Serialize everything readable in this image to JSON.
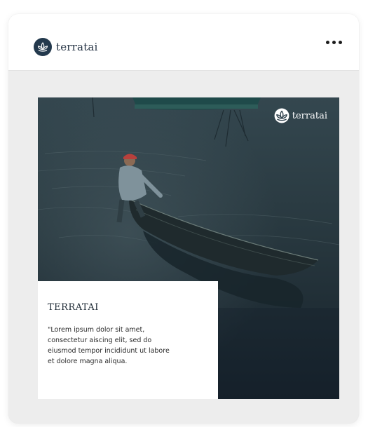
{
  "header": {
    "brand_name": "terratai",
    "logo_icon": "lotus-icon",
    "menu_icon": "more-horizontal-icon"
  },
  "post": {
    "watermark_text": "terratai",
    "caption_title": "TERRATAI",
    "caption_text": "\"Lorem ipsum dolor sit amet, consectetur aiscing elit, sed do eiusmod tempor incididunt ut labore et dolore magna aliqua."
  },
  "colors": {
    "brand_navy": "#23394d",
    "card_background": "#ededed",
    "water_dark": "#1e2c35"
  }
}
